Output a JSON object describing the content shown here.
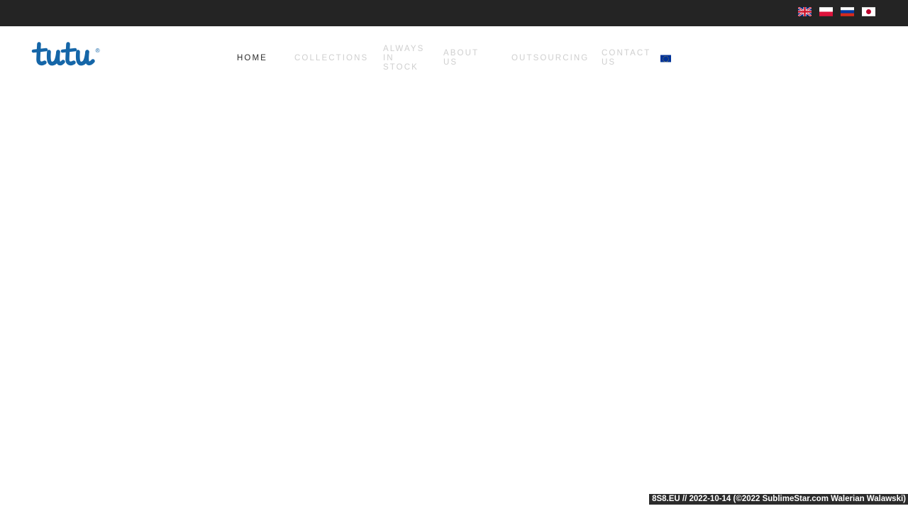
{
  "topbar": {
    "languages": [
      {
        "name": "flag-en-icon",
        "label": "English",
        "code": "en"
      },
      {
        "name": "flag-pl-icon",
        "label": "Polski",
        "code": "pl"
      },
      {
        "name": "flag-ru-icon",
        "label": "Русский",
        "code": "ru"
      },
      {
        "name": "flag-jp-icon",
        "label": "日本語",
        "code": "jp"
      }
    ],
    "background": "#242424"
  },
  "header": {
    "logo": {
      "text": "tutu",
      "trademark": "®",
      "color": "#1566a8"
    },
    "nav": {
      "items": [
        {
          "label": "HOME",
          "active": true
        },
        {
          "label": "COLLECTIONS",
          "active": false
        },
        {
          "label": "ALWAYS IN STOCK",
          "active": false
        },
        {
          "label": "ABOUT US",
          "active": false
        },
        {
          "label": "OUTSOURCING",
          "active": false
        },
        {
          "label": "CONTACT US",
          "active": false
        }
      ],
      "eu_flag": {
        "name": "flag-eu-icon",
        "label": "EU"
      },
      "active_color": "#2b2b2b",
      "inactive_color": "#cfcfcf"
    }
  },
  "footer": {
    "status_text": "8S8.EU // 2022-10-14 (©2022 SublimeStar.com Walerian Walawski)",
    "background": "#2b2b2b",
    "color": "#ffffff"
  }
}
